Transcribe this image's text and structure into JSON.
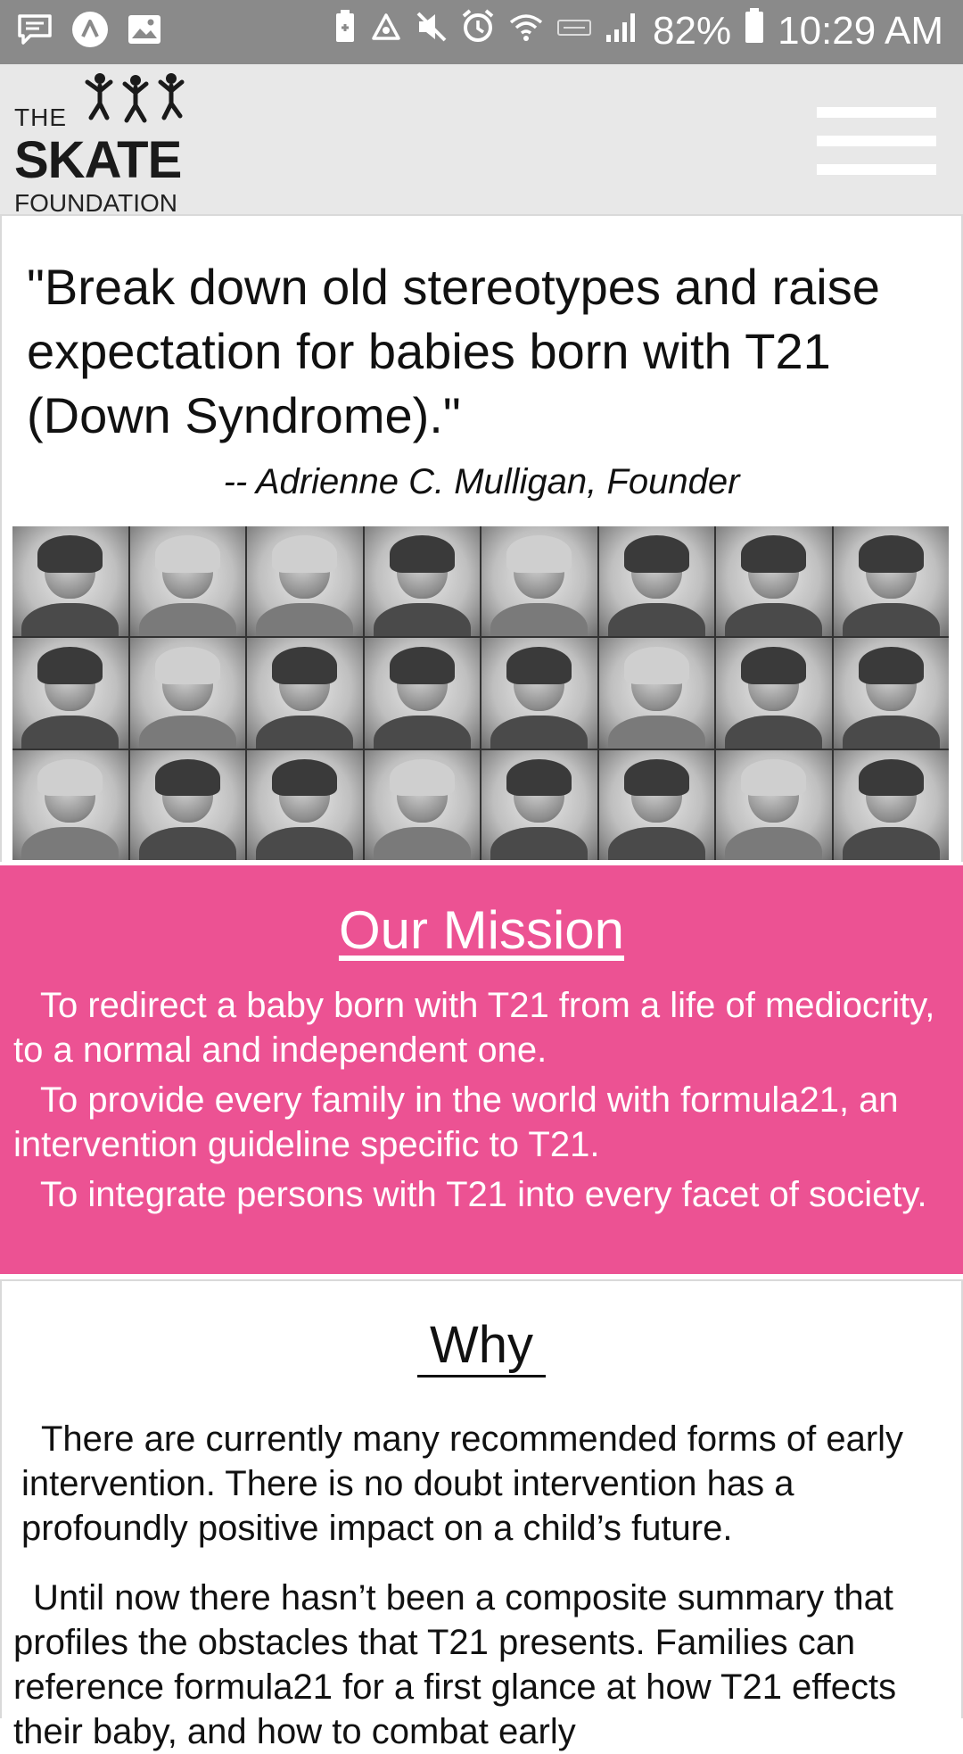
{
  "status_bar": {
    "battery": "82%",
    "time": "10:29 AM"
  },
  "header": {
    "logo": {
      "the": "THE",
      "skate": "SKATE",
      "foundation": "FOUNDATION"
    }
  },
  "quote": {
    "text": "\"Break down old stereotypes and raise expectation for babies born with T21 (Down Syndrome).\"",
    "author": "-- Adrienne C. Mulligan, Founder"
  },
  "mission": {
    "title": "Our Mission",
    "items": [
      "To redirect a baby born with T21 from a life of mediocrity, to a normal and independent one.",
      "To provide every family in the world with formula21, an intervention guideline specific to T21.",
      "To integrate persons with T21 into every facet of society."
    ]
  },
  "why": {
    "title": "Why",
    "paragraphs": [
      "There are currently many recommended forms of early intervention. There is no doubt intervention has a profoundly positive impact on a child’s future.",
      "Until now there hasn’t been a composite summary that profiles the obstacles that T21 presents. Families can reference formula21 for a first glance at how T21 effects their baby, and how to combat early"
    ]
  },
  "colors": {
    "status_bar": "#8a8a8a",
    "header_bg": "#e8e8e8",
    "mission_bg": "#ec5293"
  }
}
